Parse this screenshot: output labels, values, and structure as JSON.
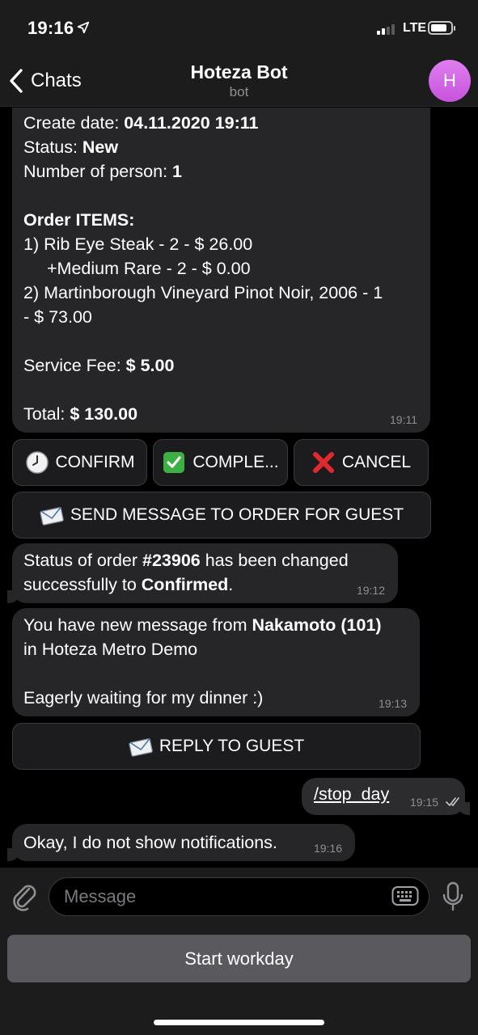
{
  "status_bar": {
    "time": "19:16",
    "network": "LTE"
  },
  "nav": {
    "back_label": "Chats",
    "title": "Hoteza Bot",
    "subtitle": "bot",
    "avatar_initial": "H"
  },
  "order_message": {
    "create_date_label": "Create date: ",
    "create_date_value": "04.11.2020 19:11",
    "status_label": "Status: ",
    "status_value": "New",
    "persons_label": "Number of person: ",
    "persons_value": "1",
    "items_header": "Order ITEMS:",
    "item1": "1) Rib Eye Steak - 2 - $ 26.00",
    "item1_mod": "+Medium Rare - 2 - $ 0.00",
    "item2_line1": "2) Martinborough Vineyard Pinot Noir, 2006 - 1",
    "item2_line2": "- $ 73.00",
    "fee_label": "Service Fee: ",
    "fee_value": "$ 5.00",
    "total_label": "Total: ",
    "total_value": "$ 130.00",
    "time": "19:11"
  },
  "inline_buttons": {
    "confirm": "CONFIRM",
    "complete": "COMPLE...",
    "cancel": "CANCEL",
    "send_message": "SEND MESSAGE TO ORDER FOR GUEST",
    "reply": "REPLY TO GUEST"
  },
  "status_message": {
    "part1": "Status of order ",
    "order_number": "#23906",
    "part2": " has been changed",
    "part3": "successfully to ",
    "new_status": "Confirmed",
    "part4": ".",
    "time": "19:12"
  },
  "guest_message": {
    "part1": "You have new message from ",
    "guest_name": "Nakamoto (101)",
    "line2": "in Hoteza Metro Demo",
    "message": "Eagerly waiting for my dinner :)",
    "time": "19:13"
  },
  "outgoing": {
    "command": "/stop_day",
    "time": "19:15"
  },
  "reply_message": {
    "text": "Okay, I do not show notifications.",
    "time": "19:16"
  },
  "input": {
    "placeholder": "Message"
  },
  "keyboard": {
    "start_workday": "Start workday"
  },
  "colors": {
    "avatar": "#d06be6",
    "bubble": "#262628",
    "background": "#000000",
    "confirm_green": "#3cb043",
    "cancel_red": "#e0282e"
  }
}
